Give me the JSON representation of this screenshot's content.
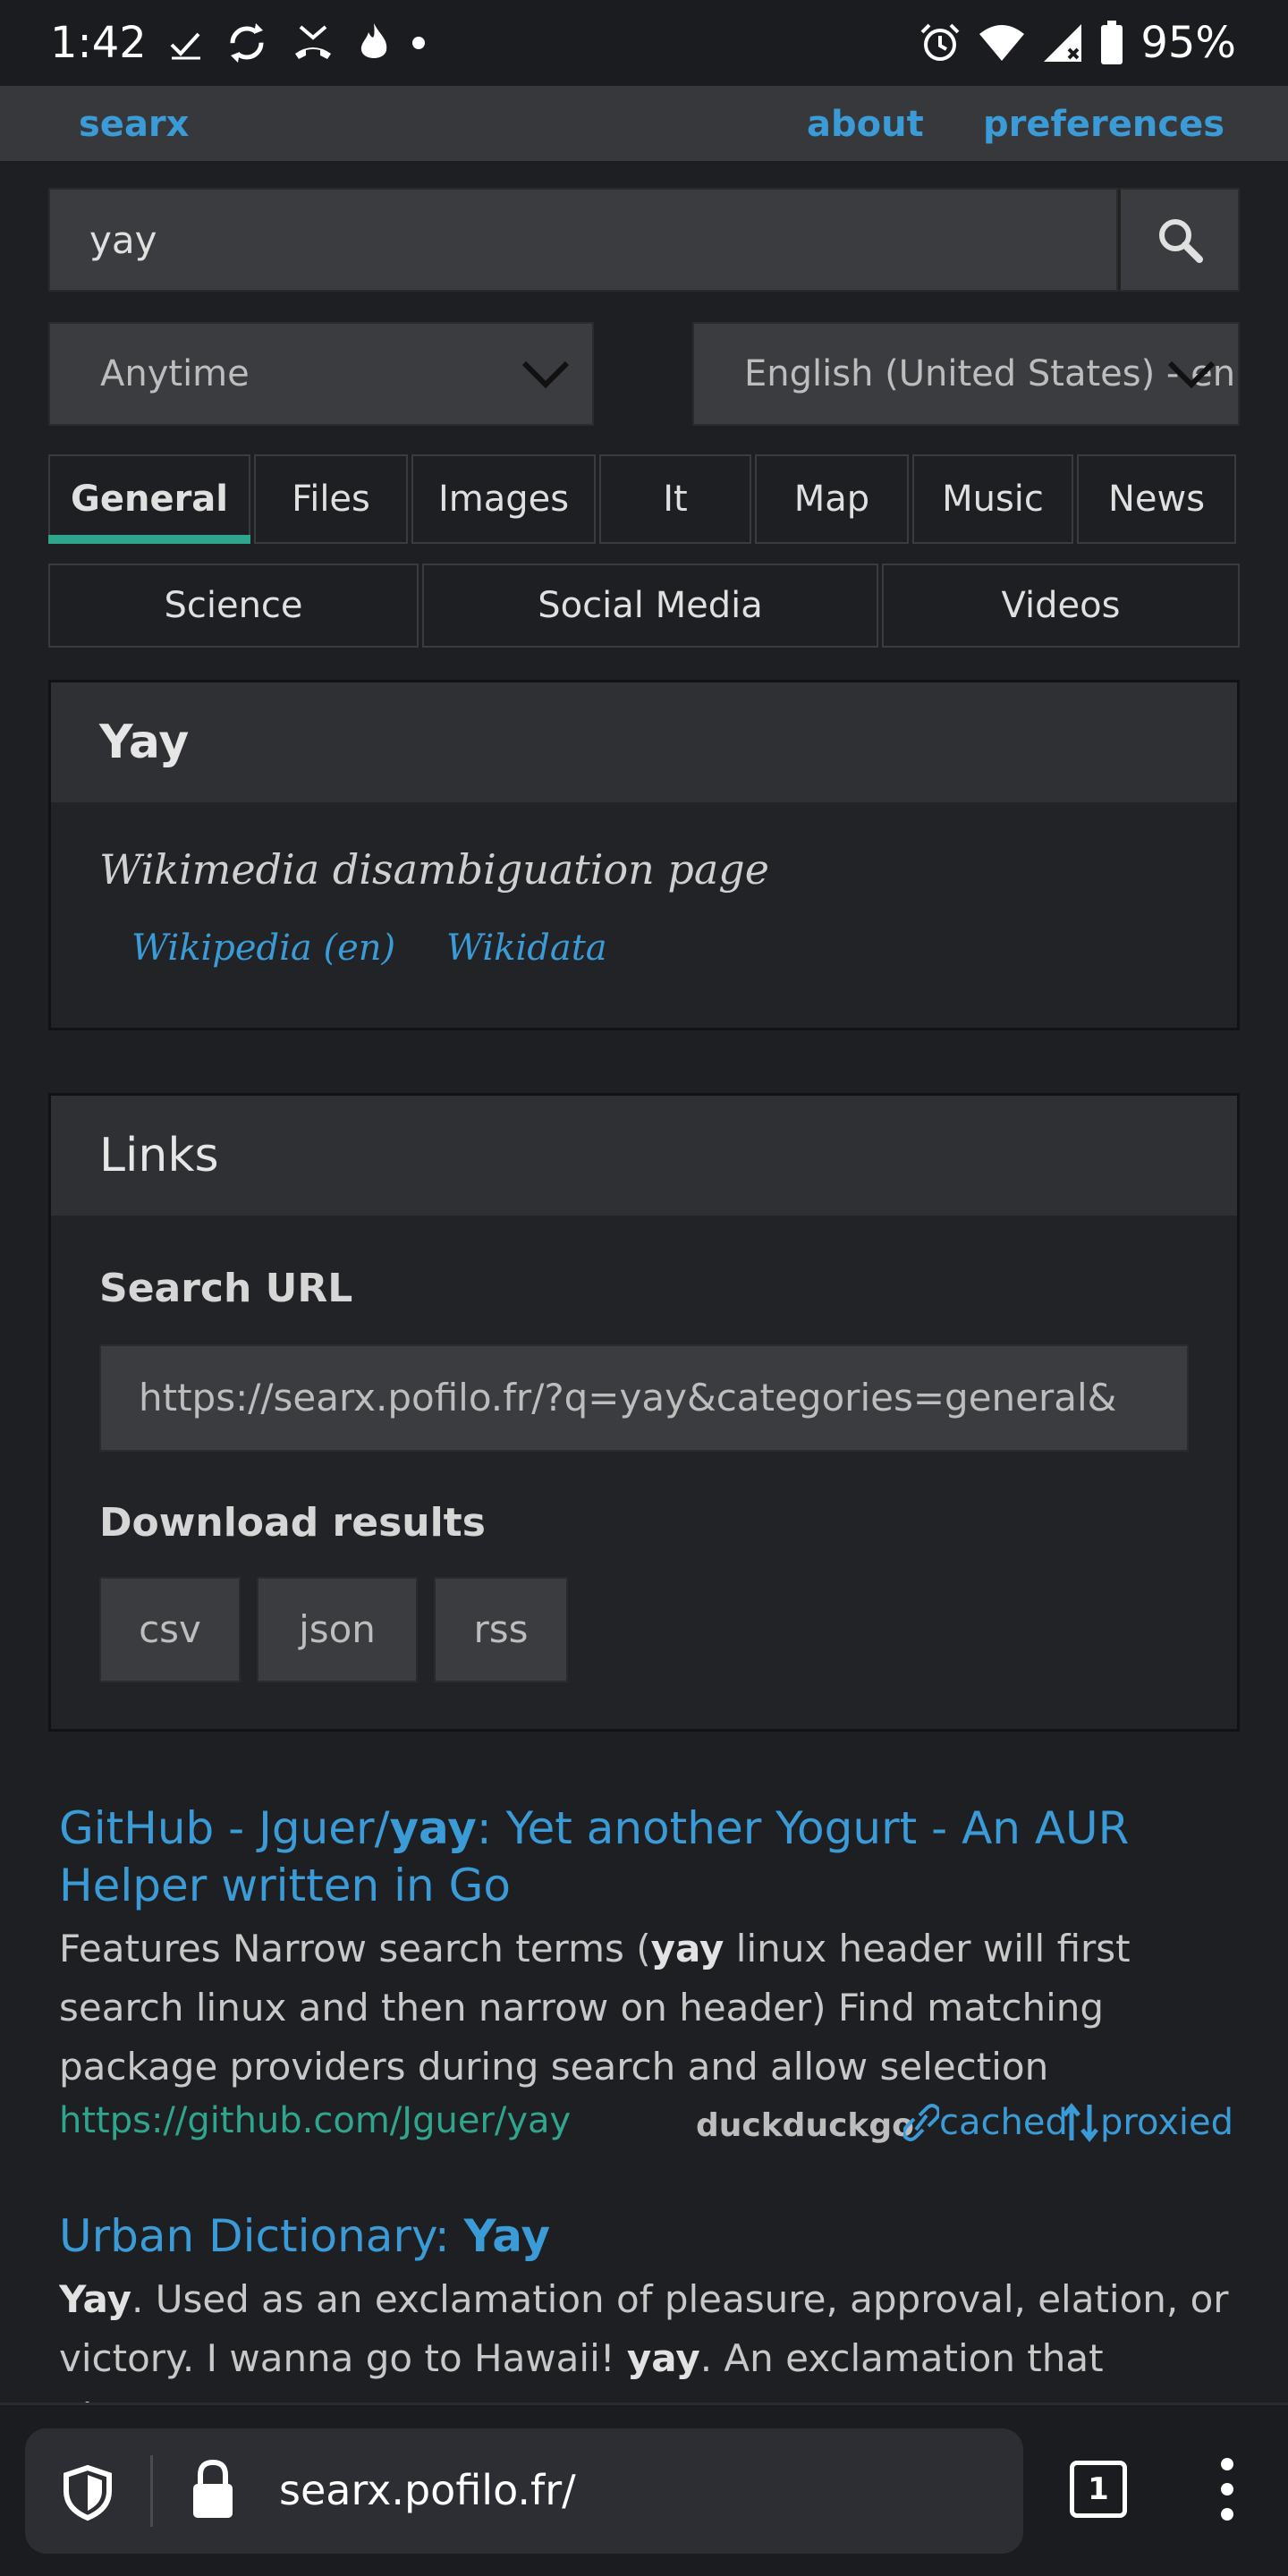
{
  "status": {
    "time": "1:42",
    "battery": "95%"
  },
  "nav": {
    "brand": "searx",
    "about": "about",
    "preferences": "preferences"
  },
  "search": {
    "query": "yay",
    "time_range": "Anytime",
    "language": "English (United States) - en"
  },
  "tabs_row1": [
    "General",
    "Files",
    "Images",
    "It",
    "Map",
    "Music",
    "News"
  ],
  "tabs_row2": [
    "Science",
    "Social Media",
    "Videos"
  ],
  "infobox": {
    "title": "Yay",
    "description": "Wikimedia disambiguation page",
    "link1": "Wikipedia (en)",
    "link2": "Wikidata"
  },
  "links": {
    "title": "Links",
    "search_url_label": "Search URL",
    "search_url": "https://searx.pofilo.fr/?q=yay&categories=general&",
    "download_label": "Download results",
    "csv": "csv",
    "json": "json",
    "rss": "rss"
  },
  "results": [
    {
      "title_pre": "GitHub - Jguer/",
      "title_bold": "yay",
      "title_post": ": Yet another Yogurt - An AUR Helper written in Go",
      "content_pre": "Features Narrow search terms (",
      "content_bold": "yay",
      "content_post": " linux header will first search linux and then narrow on header) Find matching package providers during search and allow selection",
      "url": "https://github.com/Jguer/yay",
      "engine": "duckduckgo",
      "cached": "cached",
      "proxied": "proxied"
    },
    {
      "title_pre": "Urban Dictionary: ",
      "title_bold": "Yay",
      "content_bold1": "Yay",
      "content_mid": ". Used as an exclamation of pleasure, approval, elation, or victory. I wanna go to Hawaii! ",
      "content_bold2": "yay",
      "content_post": ". An exclamation that always"
    }
  ],
  "browser": {
    "url": "searx.pofilo.fr/",
    "tab_count": "1"
  }
}
